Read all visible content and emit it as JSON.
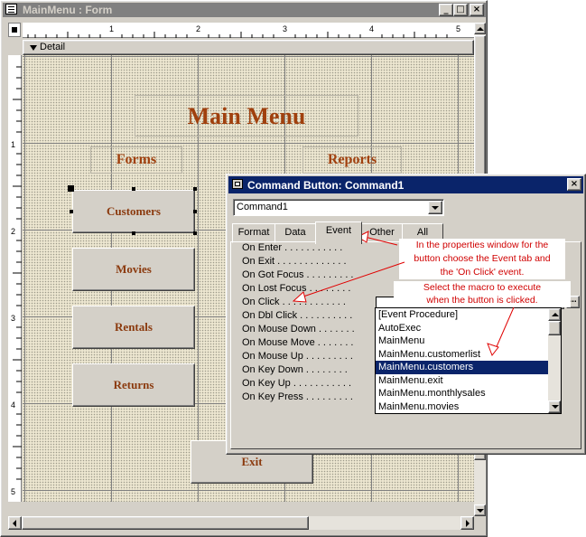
{
  "window": {
    "title": "MainMenu : Form",
    "controls": [
      "_",
      "□",
      "×"
    ]
  },
  "ruler": {
    "top_marks": [
      "1",
      "2",
      "3",
      "4",
      "5"
    ],
    "left_marks": [
      "1",
      "2",
      "3",
      "4",
      "5"
    ]
  },
  "section": {
    "label": "Detail"
  },
  "form": {
    "title": "Main Menu",
    "forms_label": "Forms",
    "reports_label": "Reports",
    "buttons": {
      "customers": "Customers",
      "movies": "Movies",
      "rentals": "Rentals",
      "returns": "Returns",
      "exit": "Exit"
    }
  },
  "props": {
    "title": "Command Button: Command1",
    "object_select": "Command1",
    "tabs": [
      "Format",
      "Data",
      "Event",
      "Other",
      "All"
    ],
    "active_tab": "Event",
    "rows": [
      "On Enter . . . . . . . . . . .",
      "On Exit . . . . . . . . . . . . .",
      "On Got Focus . . . . . . . . .",
      "On Lost Focus . . . . . . . .",
      "On Click . . . . . . . . . . . .",
      "On Dbl Click . . . . . . . . . .",
      "On Mouse Down . . . . . . .",
      "On Mouse Move . . . . . . .",
      "On Mouse Up . . . . . . . . .",
      "On Key Down . . . . . . . .",
      "On Key Up . . . . . . . . . . .",
      "On Key Press . . . . . . . . ."
    ],
    "dropdown_items": [
      "[Event Procedure]",
      "AutoExec",
      "MainMenu",
      "MainMenu.customerlist",
      "MainMenu.customers",
      "MainMenu.exit",
      "MainMenu.monthlysales",
      "MainMenu.movies"
    ],
    "selected_item": "MainMenu.customers",
    "builder_label": "..."
  },
  "annotation": {
    "lines": [
      "In the properties window for the",
      "button choose the Event tab and",
      "the 'On Click' event.",
      "Select the macro to execute",
      "when the button is clicked."
    ]
  },
  "colors": {
    "accent": "#0a246a",
    "brand_text": "#a0400e",
    "note_text": "#d00000"
  }
}
